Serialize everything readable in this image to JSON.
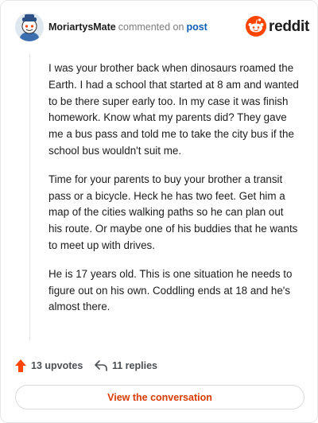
{
  "header": {
    "username": "MoriartysMate",
    "verb": "commented on",
    "post_link": "post",
    "brand": "reddit"
  },
  "comment": {
    "paragraphs": [
      "I was your brother back when dinosaurs roamed the Earth. I had a school that started at 8 am and wanted to be there super early too. In my case it was finish homework. Know what my parents did? They gave me a bus pass and told me to take the city bus if the school bus wouldn't suit me.",
      "Time for your parents to buy your brother a transit pass or a bicycle. Heck he has two feet. Get him a map of the cities walking paths so he can plan out his route. Or maybe one of his buddies that he wants to meet up with drives.",
      "He is 17 years old. This is one situation he needs to figure out on his own. Coddling ends at 18 and he's almost there."
    ]
  },
  "actions": {
    "upvotes": "13 upvotes",
    "replies": "11 replies"
  },
  "cta": {
    "label": "View the conversation"
  },
  "icons": {
    "avatar": "snoo-avatar",
    "logo": "reddit-snoo-icon",
    "upvote": "upvote-arrow-icon",
    "reply": "reply-arrow-icon"
  },
  "colors": {
    "brand_orange": "#ff4500",
    "link_blue": "#0a5fb8",
    "cta_text": "#d93a00"
  }
}
